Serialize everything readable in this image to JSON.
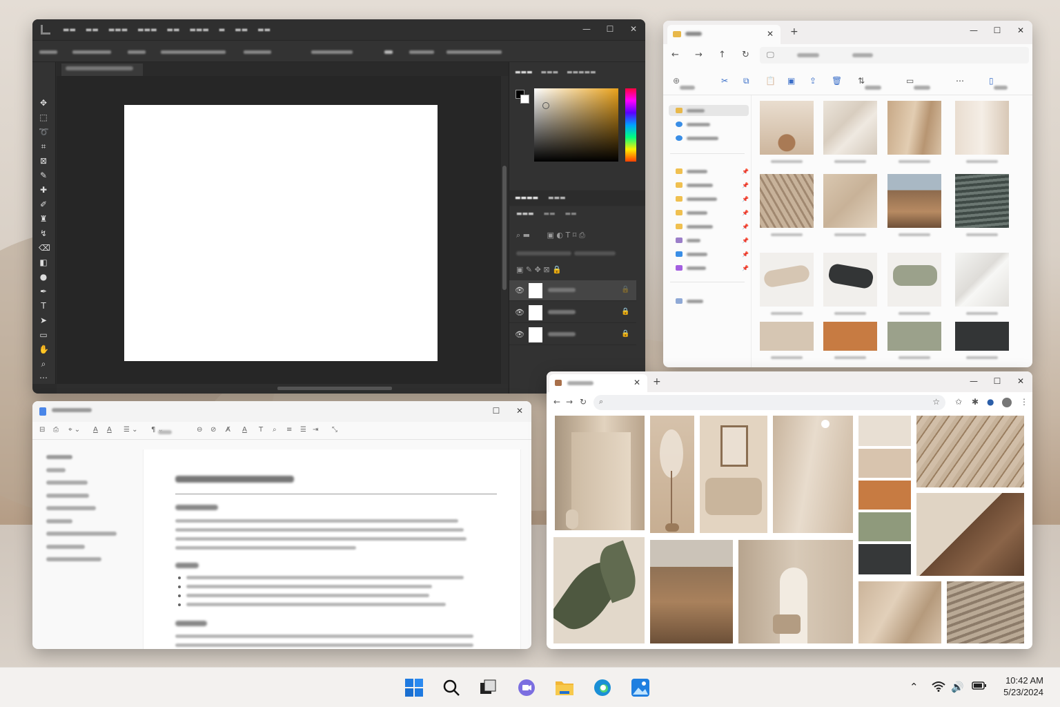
{
  "taskbar": {
    "time": "10:42 AM",
    "date": "5/23/2024",
    "pinned": [
      "windows-start",
      "search",
      "task-view",
      "chat",
      "file-explorer",
      "edge",
      "photos"
    ]
  },
  "explorer": {
    "swatch_colors": [
      "#d6c6b3",
      "#c77b42",
      "#9ba18b",
      "#333536"
    ]
  },
  "browser": {
    "palette": [
      "#e8dfd3",
      "#d8c4ae",
      "#c77b42",
      "#8f9a7c",
      "#363839"
    ]
  },
  "photoshop": {
    "canvas_color": "#ffffff",
    "foreground_color": "#000000",
    "background_color": "#ffffff"
  },
  "icons": {
    "minimize": "—",
    "maximize": "☐",
    "close": "✕",
    "new_tab": "+",
    "back": "←",
    "forward": "→",
    "up": "↑",
    "refresh": "↻",
    "more": "⋯",
    "eye": "👁",
    "lock": "🔒"
  }
}
